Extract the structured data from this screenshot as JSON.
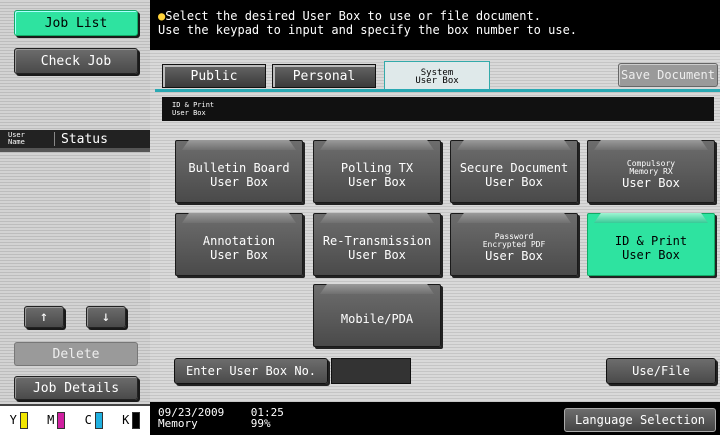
{
  "left": {
    "job_list": "Job List",
    "check_job": "Check Job",
    "user_name_l1": "User",
    "user_name_l2": "Name",
    "status": "Status",
    "up_arrow": "↑",
    "down_arrow": "↓",
    "delete": "Delete",
    "job_details": "Job Details",
    "toner": [
      {
        "label": "Y",
        "color": "#f2e600"
      },
      {
        "label": "M",
        "color": "#d020a0"
      },
      {
        "label": "C",
        "color": "#20b0e0"
      },
      {
        "label": "K",
        "color": "#000000"
      }
    ]
  },
  "message": {
    "line1": "Select the desired User Box to use or file document.",
    "line2": "Use the keypad to input and specify the box number to use."
  },
  "tabs": {
    "public": "Public",
    "personal": "Personal",
    "system_l1": "System",
    "system_l2": "User Box",
    "save_document": "Save Document"
  },
  "box_title": {
    "line1": "ID & Print",
    "line2": "User Box"
  },
  "user_boxes": [
    {
      "l1": "Bulletin Board",
      "l2": "User Box"
    },
    {
      "l1": "Polling TX",
      "l2": "User Box"
    },
    {
      "l1": "Secure Document",
      "l2": "User Box"
    },
    {
      "l1a": "Compulsory",
      "l1b": "Memory RX",
      "l2": "User Box"
    },
    {
      "l1": "Annotation",
      "l2": "User Box"
    },
    {
      "l1": "Re-Transmission",
      "l2": "User Box"
    },
    {
      "l1a": "Password",
      "l1b": "Encrypted PDF",
      "l2": "User Box"
    },
    {
      "l1": "ID & Print",
      "l2": "User Box"
    },
    {
      "l1": "Mobile/PDA"
    }
  ],
  "enter_box_no": "Enter User Box No.",
  "use_file": "Use/File",
  "status_bar": {
    "date": "09/23/2009",
    "time": "01:25",
    "memory_label": "Memory",
    "memory_value": "99%",
    "language": "Language Selection"
  },
  "colors": {
    "accent_green": "#2ee3a0",
    "tab_accent": "#2aa9b3"
  }
}
